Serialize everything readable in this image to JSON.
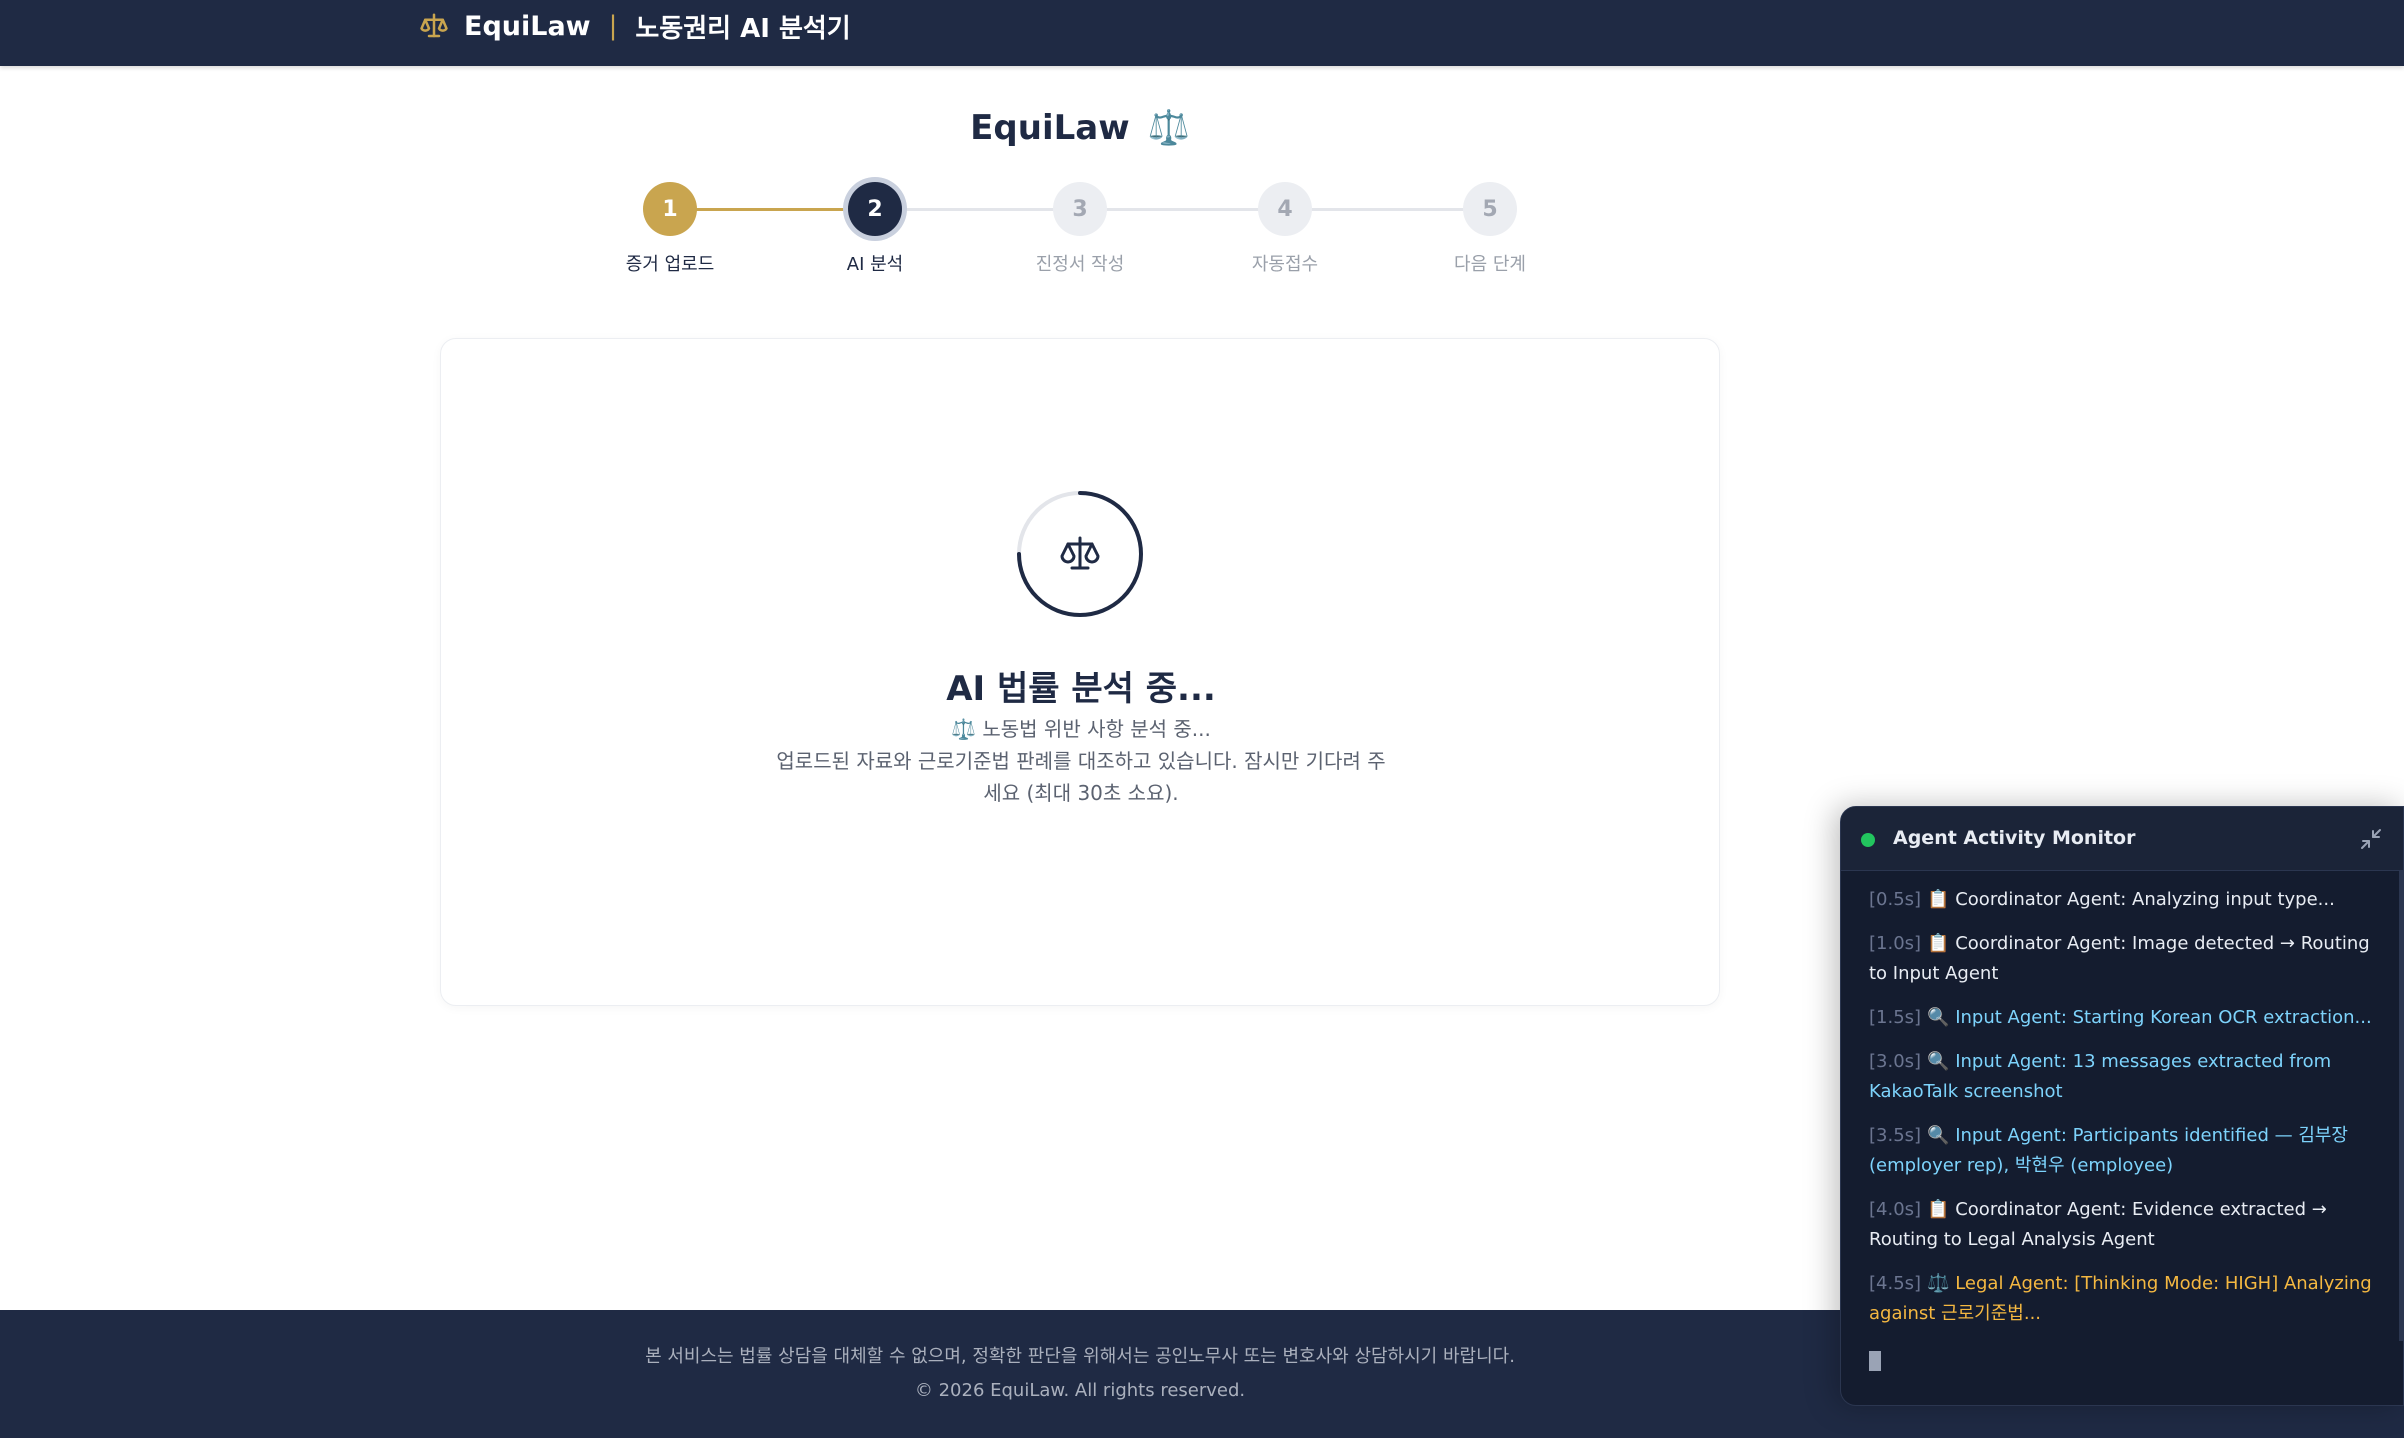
{
  "header": {
    "brand_name": "EquiLaw",
    "separator": "|",
    "subtitle": "노동권리 AI 분석기"
  },
  "page": {
    "title": "EquiLaw",
    "title_icon": "⚖️"
  },
  "stepper": {
    "steps": [
      {
        "number": "1",
        "label": "증거 업로드",
        "state": "done"
      },
      {
        "number": "2",
        "label": "AI 분석",
        "state": "active"
      },
      {
        "number": "3",
        "label": "진정서 작성",
        "state": "pending"
      },
      {
        "number": "4",
        "label": "자동접수",
        "state": "pending"
      },
      {
        "number": "5",
        "label": "다음 단계",
        "state": "pending"
      }
    ]
  },
  "analysis": {
    "title": "AI 법률 분석 중...",
    "line1": "⚖️ 노동법 위반 사항 분석 중...",
    "line2": "업로드된 자료와 근로기준법 판례를 대조하고 있습니다. 잠시만 기다려 주세요 (최대 30초 소요)."
  },
  "footer": {
    "disclaimer": "본 서비스는 법률 상담을 대체할 수 없으며, 정확한 판단을 위해서는 공인노무사 또는 변호사와 상담하시기 바랍니다.",
    "copyright": "© 2026 EquiLaw. All rights reserved."
  },
  "monitor": {
    "title": "Agent Activity Monitor",
    "status_color": "#22c55e",
    "entries": [
      {
        "time": "[0.5s]",
        "icon": "📋",
        "text": "Coordinator Agent: Analyzing input type...",
        "kind": "coordinator"
      },
      {
        "time": "[1.0s]",
        "icon": "📋",
        "text": "Coordinator Agent: Image detected → Routing to Input Agent",
        "kind": "coordinator"
      },
      {
        "time": "[1.5s]",
        "icon": "🔍",
        "text": "Input Agent: Starting Korean OCR extraction...",
        "kind": "input"
      },
      {
        "time": "[3.0s]",
        "icon": "🔍",
        "text": "Input Agent: 13 messages extracted from KakaoTalk screenshot",
        "kind": "input"
      },
      {
        "time": "[3.5s]",
        "icon": "🔍",
        "text": "Input Agent: Participants identified — 김부장 (employer rep), 박현우 (employee)",
        "kind": "input"
      },
      {
        "time": "[4.0s]",
        "icon": "📋",
        "text": "Coordinator Agent: Evidence extracted → Routing to Legal Analysis Agent",
        "kind": "coordinator"
      },
      {
        "time": "[4.5s]",
        "icon": "⚖️",
        "text": "Legal Agent: [Thinking Mode: HIGH] Analyzing against 근로기준법...",
        "kind": "legal"
      }
    ]
  },
  "colors": {
    "navy": "#1f2a44",
    "gold": "#c9a54f",
    "input_agent": "#7dd3fc",
    "legal_agent": "#f5b841"
  }
}
